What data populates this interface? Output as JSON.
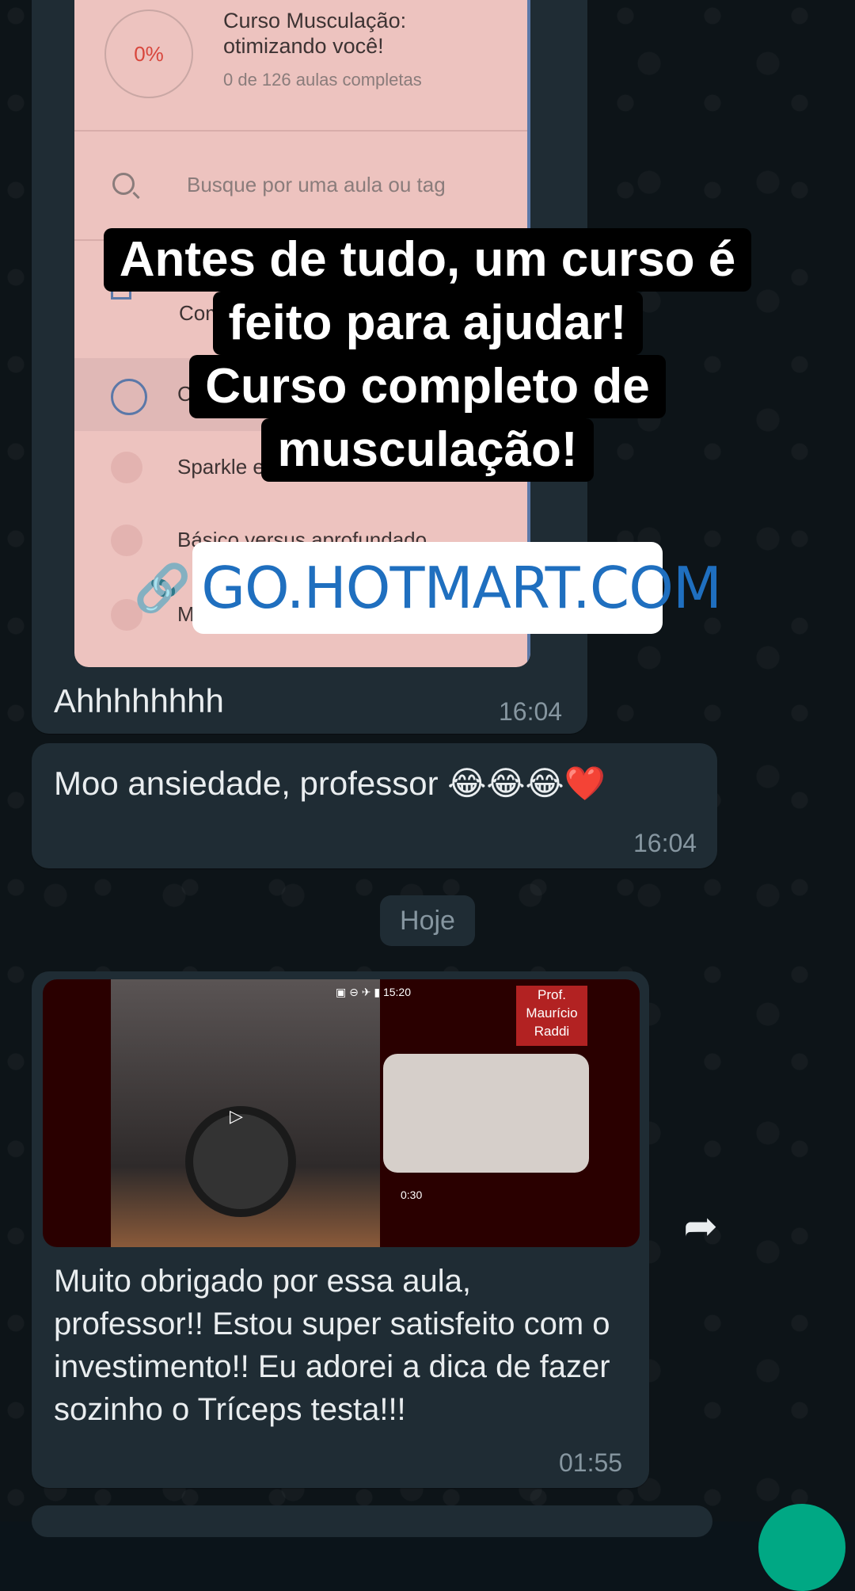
{
  "screenshot_card": {
    "progress": "0%",
    "course_title": "Curso Musculação: otimizando você!",
    "course_progress": "0 de 126 aulas completas",
    "search_placeholder": "Busque por uma aula ou tag",
    "lessons": [
      "Come",
      "Con",
      "Sparkle e ca",
      "Básico versus aprofundado",
      "Mont"
    ]
  },
  "overlay_caption": {
    "line1": "Antes de tudo,  um curso é",
    "line2": "feito para ajudar!",
    "line3": "Curso completo de",
    "line4": "musculação!"
  },
  "link_sticker": {
    "text": "GO.HOTMART.COM",
    "icon": "link-icon"
  },
  "messages": [
    {
      "text": "Ahhhhhhhh",
      "time": "16:04"
    },
    {
      "text": "Moo ansiedade, professor 😂😂😂❤️",
      "time": "16:04"
    }
  ],
  "day_separator": "Hoje",
  "video_message": {
    "statusbar": "▣ ⊖ ✈ ▮ 15:20",
    "badge": "Prof. Maurício Raddi",
    "video_time": "0:30",
    "text": "Muito obrigado por essa aula, professor!! Estou super satisfeito com o investimento!! Eu adorei a dica de fazer sozinho o Tríceps testa!!!",
    "time": "01:55"
  }
}
